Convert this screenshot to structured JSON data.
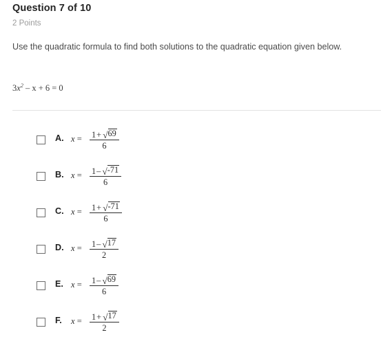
{
  "question": {
    "title": "Question 7 of 10",
    "points": "2 Points",
    "prompt": "Use the quadratic formula to find both solutions to the quadratic equation given below.",
    "equation": {
      "coefficient": "3",
      "variable": "x",
      "exponent": "2",
      "rest": "– x + 6 = 0",
      "full_text": "3x2 – x + 6 = 0"
    }
  },
  "options": [
    {
      "letter": "A.",
      "x_equals": "x =",
      "numerator_sign": "+",
      "numerator_lead": "1",
      "radicand": "69",
      "denominator": "6",
      "full_text": "x = (1 + √69) / 6",
      "checked": false
    },
    {
      "letter": "B.",
      "x_equals": "x =",
      "numerator_sign": "–",
      "numerator_lead": "1",
      "radicand": "-71",
      "denominator": "6",
      "full_text": "x = (1 – √-71) / 6",
      "checked": false
    },
    {
      "letter": "C.",
      "x_equals": "x =",
      "numerator_sign": "+",
      "numerator_lead": "1",
      "radicand": "-71",
      "denominator": "6",
      "full_text": "x = (1 + √-71) / 6",
      "checked": false
    },
    {
      "letter": "D.",
      "x_equals": "x =",
      "numerator_sign": "–",
      "numerator_lead": "1",
      "radicand": "17",
      "denominator": "2",
      "full_text": "x = (1 – √17) / 2",
      "checked": false
    },
    {
      "letter": "E.",
      "x_equals": "x =",
      "numerator_sign": "–",
      "numerator_lead": "1",
      "radicand": "69",
      "denominator": "6",
      "full_text": "x = (1 – √69) / 6",
      "checked": false
    },
    {
      "letter": "F.",
      "x_equals": "x =",
      "numerator_sign": "+",
      "numerator_lead": "1",
      "radicand": "17",
      "denominator": "2",
      "full_text": "x = (1 + √17) / 2",
      "checked": false
    }
  ],
  "icons": {
    "radical": "√",
    "checkbox": "checkbox-unchecked"
  },
  "colors": {
    "background": "#ffffff",
    "title": "#242424",
    "points": "#9b9b9b",
    "body": "#4a4a4a",
    "math": "#2b2b2b",
    "divider": "#e2e2e2",
    "checkbox_border": "#6b6b6b"
  }
}
